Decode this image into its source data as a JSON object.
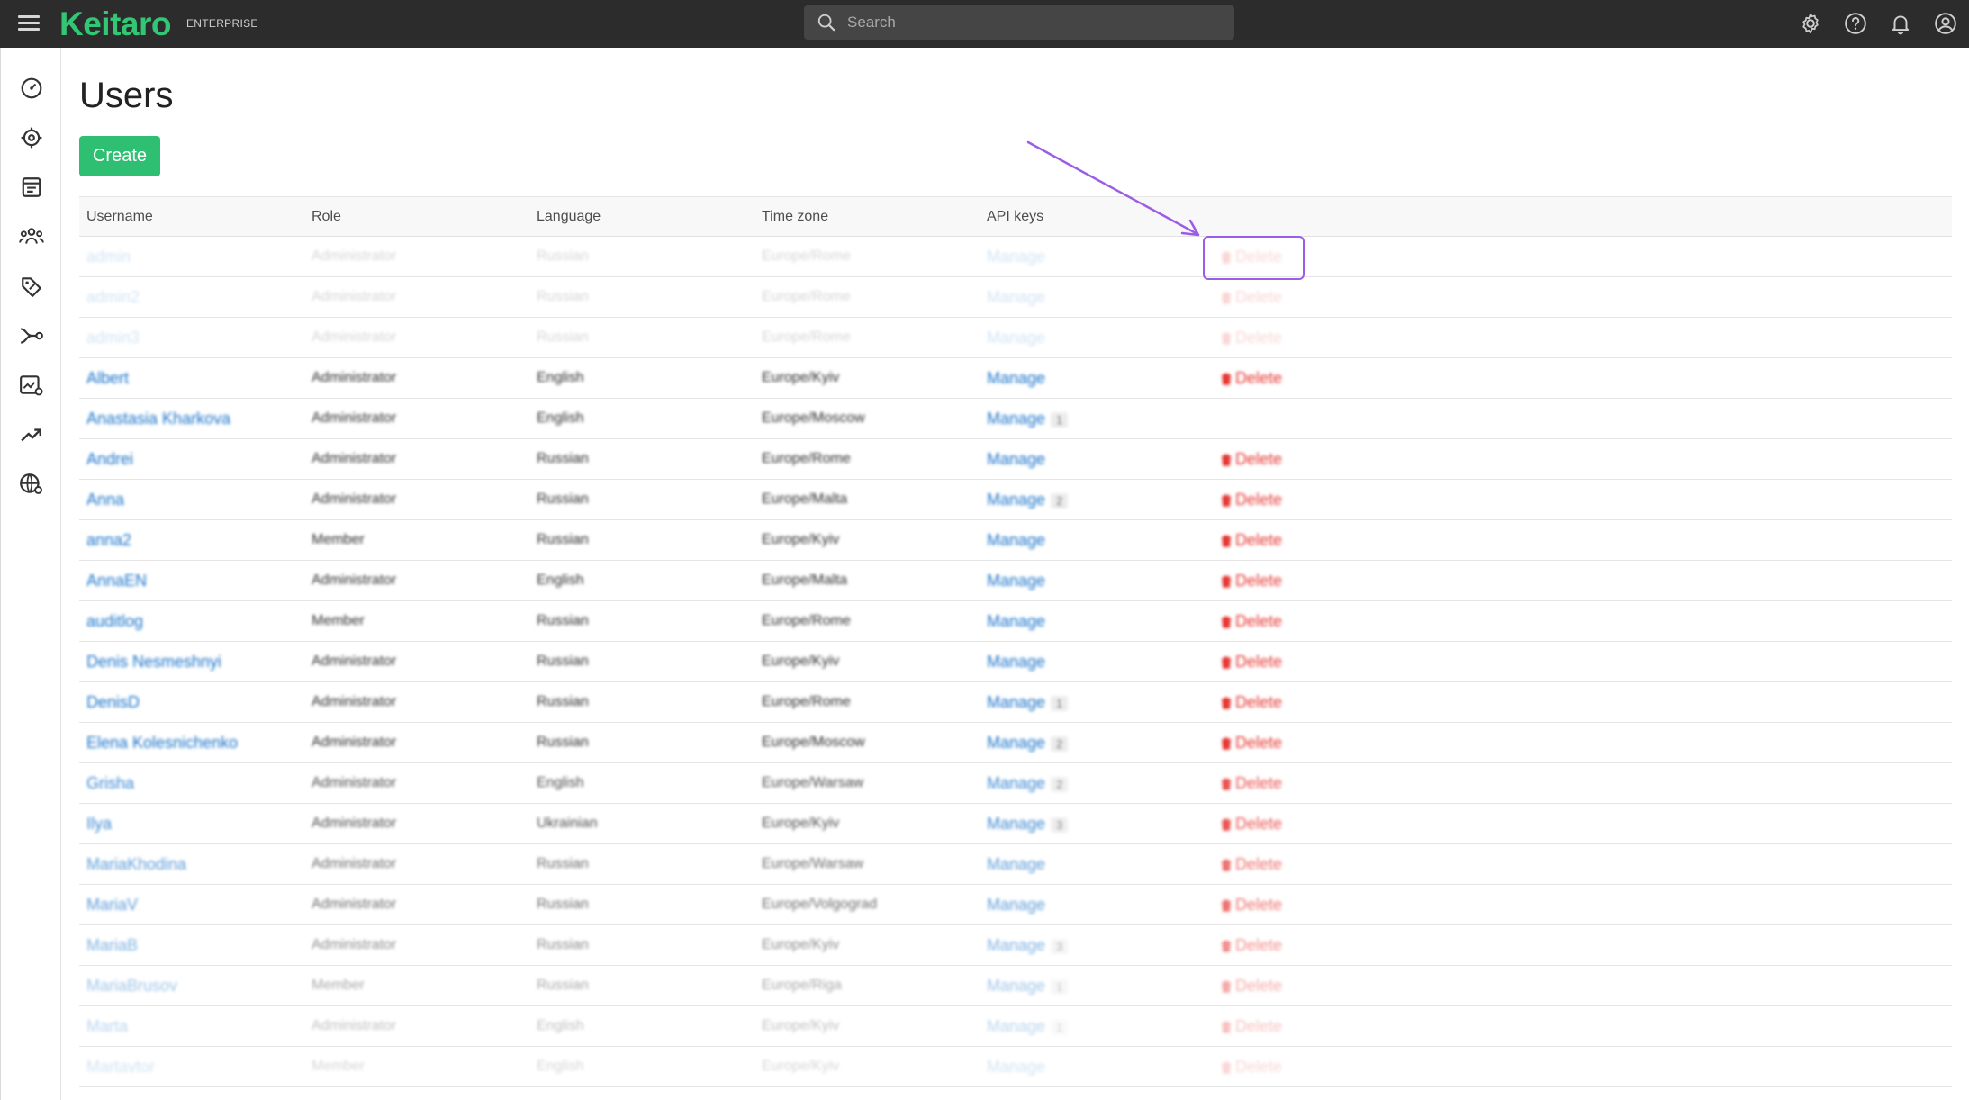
{
  "app": {
    "logo": "Keitaro",
    "edition": "ENTERPRISE",
    "search_placeholder": "Search"
  },
  "top_icons": [
    "gear-icon",
    "help-icon",
    "bell-icon",
    "account-icon"
  ],
  "sidebar_icons": [
    "dashboard-icon",
    "campaigns-icon",
    "landing-pages-icon",
    "users-group-icon",
    "offers-tag-icon",
    "flows-icon",
    "reports-icon",
    "trends-icon",
    "domains-icon"
  ],
  "page": {
    "title": "Users",
    "create_label": "Create"
  },
  "table": {
    "headers": [
      "Username",
      "Role",
      "Language",
      "Time zone",
      "API keys"
    ],
    "manage_label": "Manage",
    "delete_label": "Delete",
    "rows": [
      {
        "username": "admin",
        "role": "Administrator",
        "language": "Russian",
        "timezone": "Europe/Rome",
        "keys": "",
        "delete": true
      },
      {
        "username": "admin2",
        "role": "Administrator",
        "language": "Russian",
        "timezone": "Europe/Rome",
        "keys": "",
        "delete": true
      },
      {
        "username": "admin3",
        "role": "Administrator",
        "language": "Russian",
        "timezone": "Europe/Rome",
        "keys": "",
        "delete": true
      },
      {
        "username": "Albert",
        "role": "Administrator",
        "language": "English",
        "timezone": "Europe/Kyiv",
        "keys": "",
        "delete": true
      },
      {
        "username": "Anastasia Kharkova",
        "role": "Administrator",
        "language": "English",
        "timezone": "Europe/Moscow",
        "keys": "1",
        "delete": false
      },
      {
        "username": "Andrei",
        "role": "Administrator",
        "language": "Russian",
        "timezone": "Europe/Rome",
        "keys": "",
        "delete": true
      },
      {
        "username": "Anna",
        "role": "Administrator",
        "language": "Russian",
        "timezone": "Europe/Malta",
        "keys": "2",
        "delete": true
      },
      {
        "username": "anna2",
        "role": "Member",
        "language": "Russian",
        "timezone": "Europe/Kyiv",
        "keys": "",
        "delete": true
      },
      {
        "username": "AnnaEN",
        "role": "Administrator",
        "language": "English",
        "timezone": "Europe/Malta",
        "keys": "",
        "delete": true
      },
      {
        "username": "auditlog",
        "role": "Member",
        "language": "Russian",
        "timezone": "Europe/Rome",
        "keys": "",
        "delete": true
      },
      {
        "username": "Denis Nesmeshnyi",
        "role": "Administrator",
        "language": "Russian",
        "timezone": "Europe/Kyiv",
        "keys": "",
        "delete": true
      },
      {
        "username": "DenisD",
        "role": "Administrator",
        "language": "Russian",
        "timezone": "Europe/Rome",
        "keys": "1",
        "delete": true
      },
      {
        "username": "Elena Kolesnichenko",
        "role": "Administrator",
        "language": "Russian",
        "timezone": "Europe/Moscow",
        "keys": "2",
        "delete": true
      },
      {
        "username": "Grisha",
        "role": "Administrator",
        "language": "English",
        "timezone": "Europe/Warsaw",
        "keys": "2",
        "delete": true
      },
      {
        "username": "Ilya",
        "role": "Administrator",
        "language": "Ukrainian",
        "timezone": "Europe/Kyiv",
        "keys": "3",
        "delete": true
      },
      {
        "username": "MariaKhodina",
        "role": "Administrator",
        "language": "Russian",
        "timezone": "Europe/Warsaw",
        "keys": "",
        "delete": true
      },
      {
        "username": "MariaV",
        "role": "Administrator",
        "language": "Russian",
        "timezone": "Europe/Volgograd",
        "keys": "",
        "delete": true
      },
      {
        "username": "MariaB",
        "role": "Administrator",
        "language": "Russian",
        "timezone": "Europe/Kyiv",
        "keys": "3",
        "delete": true
      },
      {
        "username": "MariaBrusov",
        "role": "Member",
        "language": "Russian",
        "timezone": "Europe/Riga",
        "keys": "1",
        "delete": true
      },
      {
        "username": "Marta",
        "role": "Administrator",
        "language": "English",
        "timezone": "Europe/Kyiv",
        "keys": "1",
        "delete": true
      },
      {
        "username": "Martavtor",
        "role": "Member",
        "language": "English",
        "timezone": "Europe/Kyiv",
        "keys": "",
        "delete": true
      }
    ]
  },
  "colors": {
    "topbar": "#2c2c2c",
    "logo": "#31c774",
    "create": "#2fbf73",
    "link": "#1a73c9",
    "delete": "#e53935",
    "highlight": "#9b5de5"
  }
}
